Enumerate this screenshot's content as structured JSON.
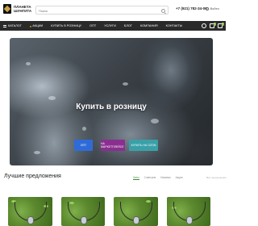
{
  "brand": {
    "line1": "ПЛАНЕТА",
    "line2": "ШУНГИТА"
  },
  "search": {
    "placeholder": "Поиск"
  },
  "header": {
    "phone": "+7 (921) 782-34-06",
    "login": "Войти"
  },
  "nav": {
    "items": [
      "Каталог",
      "Акции",
      "Купить в розницу",
      "Опт",
      "Услуги",
      "Блог",
      "Компания",
      "Контакты"
    ],
    "cart_count": "0",
    "compare_count": "0"
  },
  "hero": {
    "title": "Купить в розницу",
    "buttons": [
      "Опт",
      "На маркетплейсе",
      "Купить на Ozon"
    ]
  },
  "offers": {
    "title": "Лучшие предложения",
    "tabs": [
      "Хиты",
      "Советуем",
      "Новинки",
      "Акции"
    ],
    "all_label": "Все предложения"
  },
  "colors": {
    "nav_bg": "#2a2a2a",
    "accent": "#3a8a3a",
    "btn_blue": "#2f6bd8",
    "btn_purple": "#8a2f8f",
    "btn_teal": "#3aa0a8"
  }
}
